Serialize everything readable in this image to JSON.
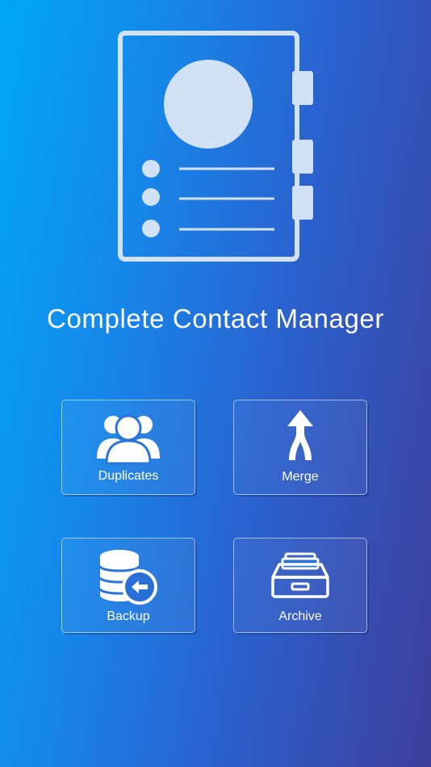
{
  "app": {
    "title": "Complete Contact Manager"
  },
  "hero": {
    "icon": "contact-book-icon"
  },
  "tiles": [
    {
      "label": "Duplicates",
      "icon": "duplicate-users-icon"
    },
    {
      "label": "Merge",
      "icon": "merge-arrow-icon"
    },
    {
      "label": "Backup",
      "icon": "database-backup-icon"
    },
    {
      "label": "Archive",
      "icon": "archive-tray-icon"
    }
  ],
  "colors": {
    "gradient_start": "#00a7f7",
    "gradient_end": "#3e3f9c",
    "icon_fill": "#d2e2f6",
    "text": "#ffffff"
  }
}
